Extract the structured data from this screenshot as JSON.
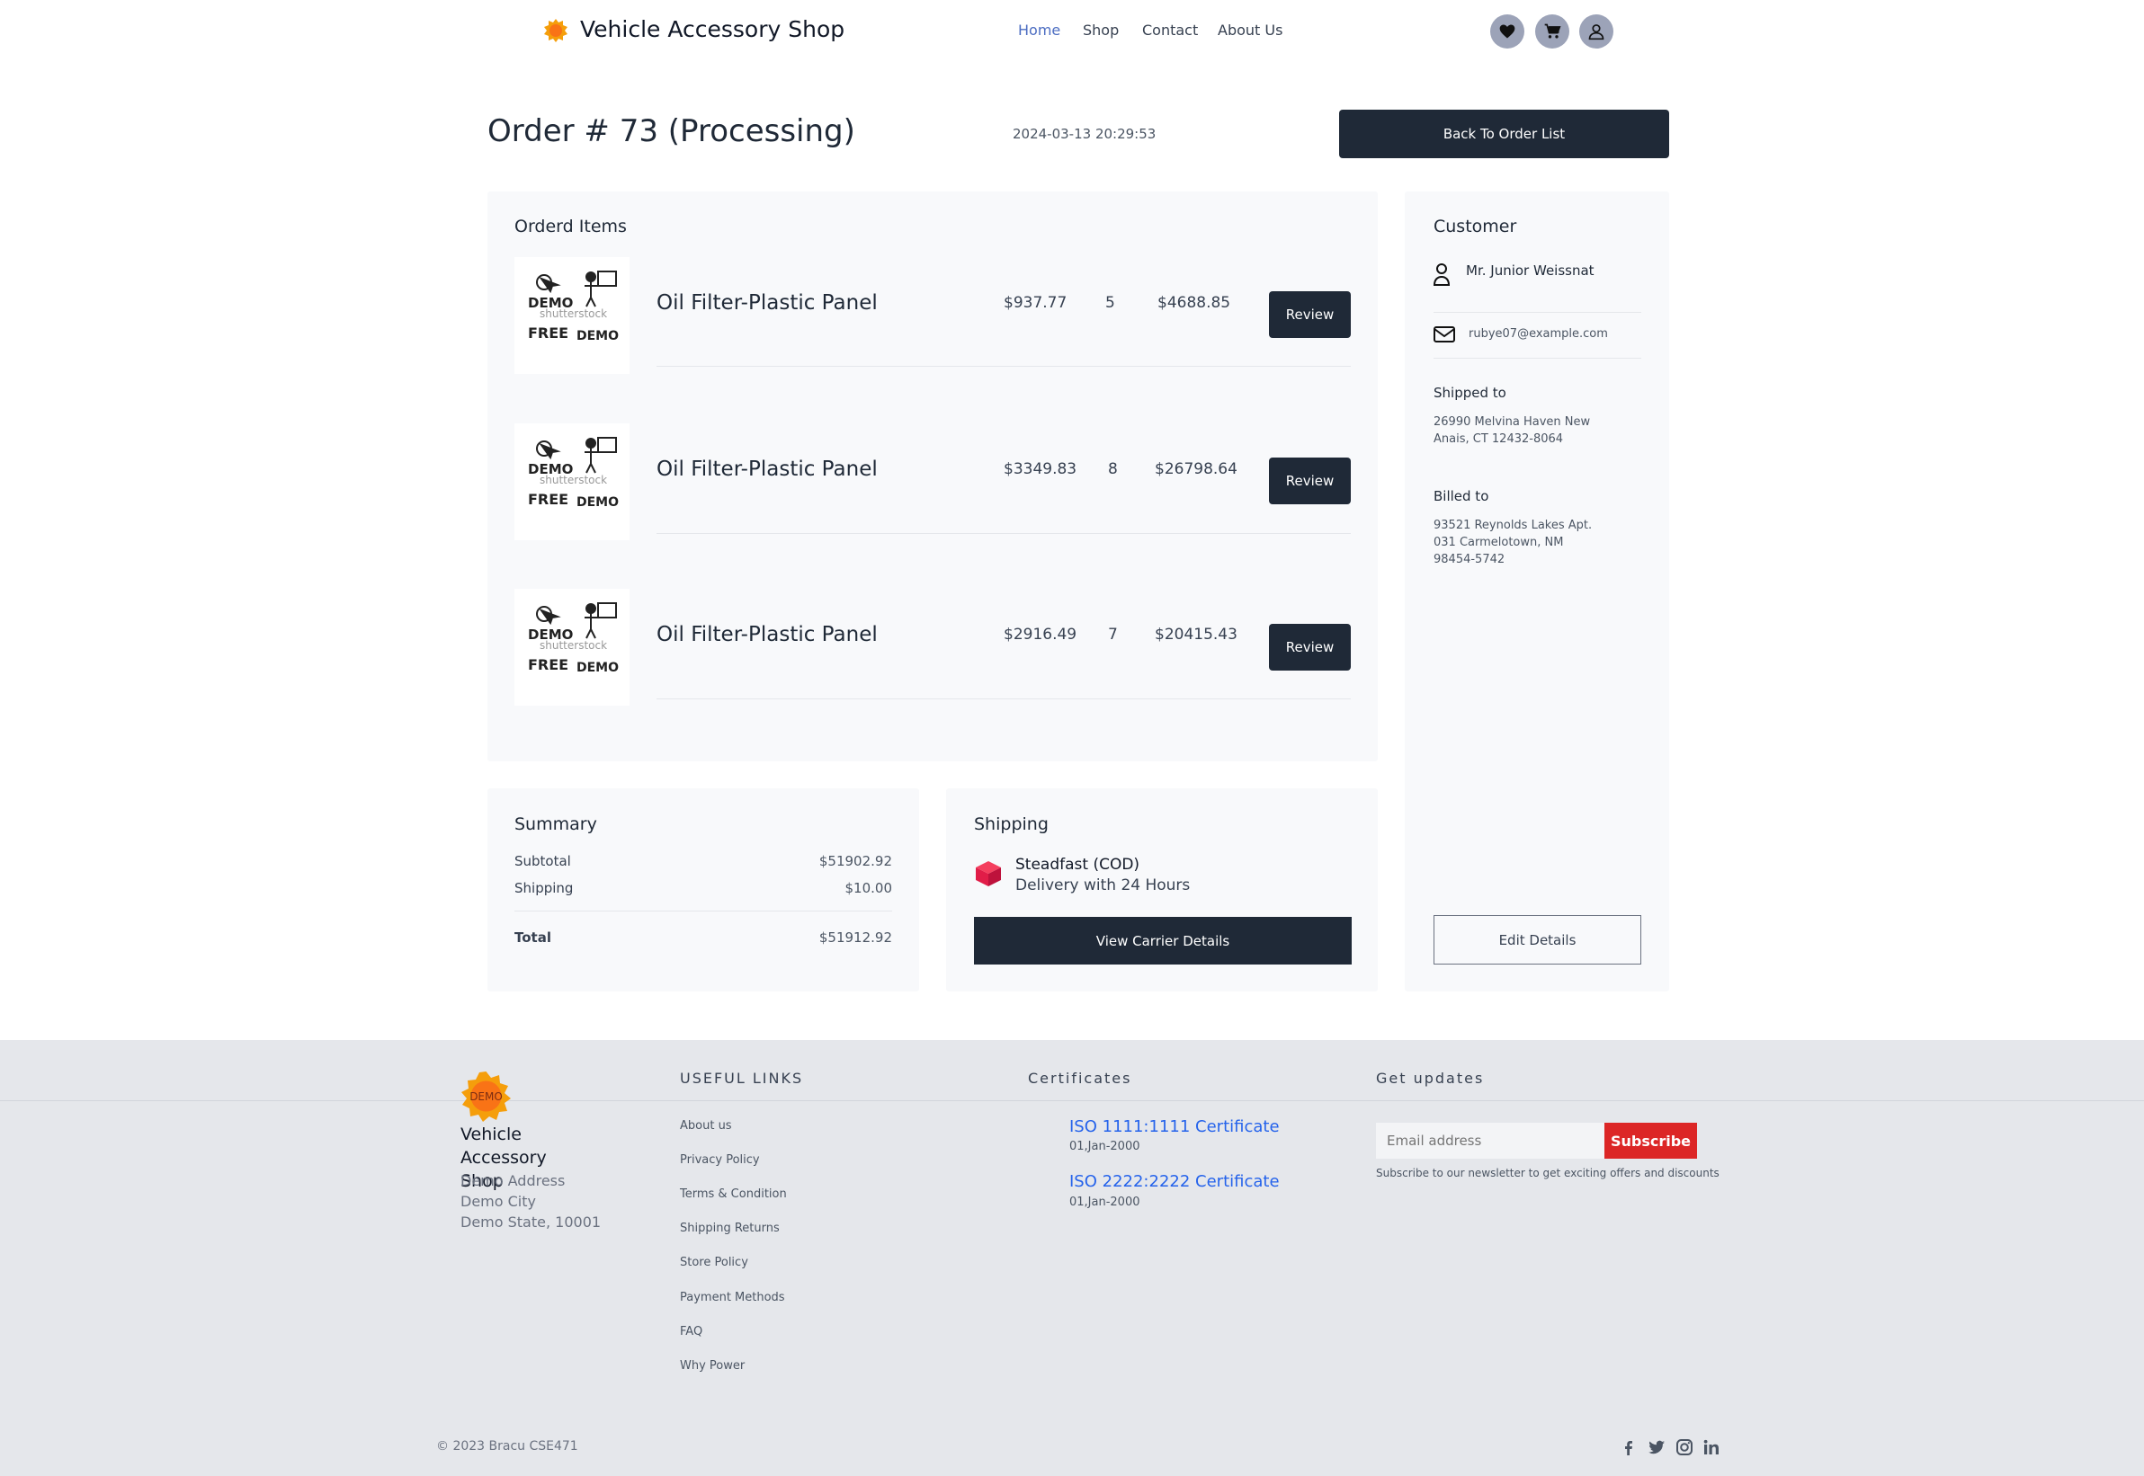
{
  "header": {
    "brand": "Vehicle Accessory Shop",
    "nav": [
      {
        "label": "Home"
      },
      {
        "label": "Shop"
      },
      {
        "label": "Contact"
      },
      {
        "label": "About Us"
      }
    ],
    "icons": [
      "heart-icon",
      "cart-icon",
      "user-icon"
    ]
  },
  "order": {
    "title": "Order # 73 (Processing)",
    "date": "2024-03-13 20:29:53",
    "back_label": "Back To Order List"
  },
  "items": {
    "title": "Orderd Items",
    "rows": [
      {
        "name": "Oil Filter-Plastic Panel",
        "price": "$937.77",
        "qty": "5",
        "total": "$4688.85",
        "action": "Review"
      },
      {
        "name": "Oil Filter-Plastic Panel",
        "price": "$3349.83",
        "qty": "8",
        "total": "$26798.64",
        "action": "Review"
      },
      {
        "name": "Oil Filter-Plastic Panel",
        "price": "$2916.49",
        "qty": "7",
        "total": "$20415.43",
        "action": "Review"
      }
    ],
    "thumb_text": {
      "demo": "DEMO",
      "watermark": "shutterstock",
      "free": "FREE",
      "demo2": "DEMO"
    }
  },
  "customer": {
    "title": "Customer",
    "name": "Mr. Junior Weissnat",
    "email": "rubye07@example.com",
    "shipped_label": "Shipped to",
    "shipped_lines": [
      "26990 Melvina Haven New",
      "Anais, CT 12432-8064"
    ],
    "billed_label": "Billed to",
    "billed_lines": [
      "93521 Reynolds Lakes Apt.",
      "031 Carmelotown, NM",
      "98454-5742"
    ],
    "edit_label": "Edit Details"
  },
  "summary": {
    "title": "Summary",
    "subtotal_label": "Subtotal",
    "subtotal": "$51902.92",
    "shipping_label": "Shipping",
    "shipping": "$10.00",
    "total_label": "Total",
    "total": "$51912.92"
  },
  "shipping": {
    "title": "Shipping",
    "carrier": "Steadfast (COD)",
    "description": "Delivery with 24 Hours",
    "button_label": "View Carrier Details"
  },
  "footer": {
    "logo_text": "DEMO",
    "brand_lines": [
      "Vehicle Accessory",
      "Shop"
    ],
    "address": [
      "Demo Address",
      "Demo City",
      "Demo State, 10001"
    ],
    "links_heading": "USEFUL LINKS",
    "links": [
      "About us",
      "Privacy Policy",
      "Terms & Condition",
      "Shipping Returns",
      "Store Policy",
      "Payment Methods",
      "FAQ",
      "Why Power"
    ],
    "certs_heading": "Certificates",
    "certs": [
      {
        "name": "ISO 1111:1111 Certificate",
        "date": "01,Jan-2000"
      },
      {
        "name": "ISO 2222:2222 Certificate",
        "date": "01,Jan-2000"
      }
    ],
    "updates_heading": "Get updates",
    "email_placeholder": "Email address",
    "subscribe_label": "Subscribe",
    "subscribe_note": "Subscribe to our newsletter to get exciting offers and discounts",
    "copyright": "© 2023 Bracu CSE471",
    "social_icons": [
      "facebook-icon",
      "twitter-icon",
      "instagram-icon",
      "linkedin-icon"
    ]
  },
  "colors": {
    "dark": "#1f2937",
    "accent_link": "#2563eb",
    "nav_active": "#4b6cc1",
    "subscribe": "#dc2626",
    "panel_bg": "#f8f9fb",
    "footer_bg": "#e5e7eb",
    "logo_orange": "#f59e0b",
    "box_red": "#e11d48"
  }
}
